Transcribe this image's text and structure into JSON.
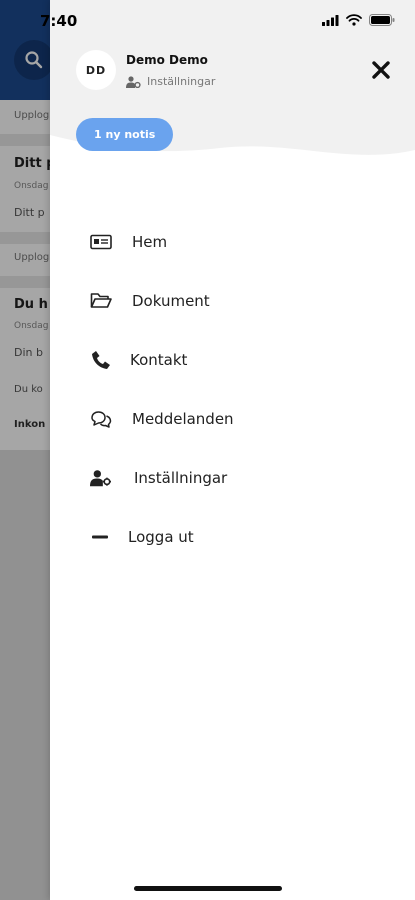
{
  "status_bar": {
    "time": "7:40"
  },
  "background": {
    "label_1": "Upplog",
    "title_1": "Ditt p",
    "meta_1": "Onsdag",
    "body_1": "Ditt p",
    "label_2": "Upplog",
    "title_2": "Du h",
    "meta_2": "Onsdag",
    "body_2": "Din b",
    "body_3": "Du ko",
    "body_4": "Inkon"
  },
  "drawer": {
    "avatar_initials": "DD",
    "user_name": "Demo Demo",
    "settings_link": "Inställningar",
    "notification_pill": "1 ny notis",
    "menu": [
      {
        "label": "Hem",
        "icon": "id-card-icon"
      },
      {
        "label": "Dokument",
        "icon": "folder-open-icon"
      },
      {
        "label": "Kontakt",
        "icon": "phone-icon"
      },
      {
        "label": "Meddelanden",
        "icon": "chat-bubbles-icon"
      },
      {
        "label": "Inställningar",
        "icon": "user-gear-icon"
      },
      {
        "label": "Logga ut",
        "icon": "minus-icon"
      }
    ]
  },
  "colors": {
    "header_bg": "#1d4b8f",
    "notification_pill": "#6aa3ee",
    "drawer_top": "#f1f1f1"
  }
}
